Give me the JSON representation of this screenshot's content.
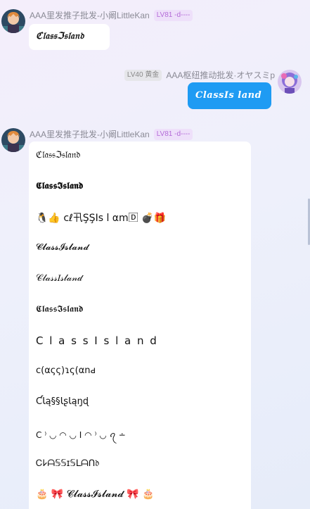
{
  "messages": [
    {
      "sender": "AAA里发推子批发-小阚LittleKan",
      "level": "LV81 -d----",
      "text": "ℭ𝔩𝔞𝔰𝔰ℑ𝔰𝔩𝔞𝔫𝔡"
    },
    {
      "sender": "AAA枢纽推动批发·オヤスミp",
      "level": "LV40 黄金",
      "text": "ClassIs land"
    },
    {
      "sender": "AAA里发推子批发-小阚LittleKan",
      "level": "LV81 -d----",
      "lines": [
        "ℭ𝔩𝔞𝔰𝔰ℑ𝔰𝔩𝔞𝔫𝔡",
        "𝕮𝖑𝖆𝖘𝖘𝕴𝖘𝖑𝖆𝖓𝖉",
        "🐧👍  cℓ卂ŞŞIs l αm🄳  💣🎁",
        "𝓒𝓵𝓪𝓼𝓼𝓘𝓼𝓵𝓪𝓷𝓭",
        "𝒞𝓁𝒶𝓈𝓈𝐼𝓈𝓁𝒶𝓃𝒹",
        "𝕮𝖑𝖆𝖘𝖘𝕴𝖘𝖑𝖆𝖓𝖉",
        "C l a s s I s l a n d",
        "c(αςς)ɿς(αnԁ",
        "ƇƖą§§ƖʂƖąŋɖ",
        "C ⁾ ◡ ◠ ◡ I ◠ ⁾ ◡ ꪖ ∸",
        "Ꮯ𐌋ᗩ𝕊𝕊ɪ𝕊ᒪᗩᑎ𝔡",
        "🎂  🎀  𝓒𝓵𝓪𝓼𝓼𝓘𝓼𝓵𝓪𝓷𝓭  🎀  🎂"
      ]
    }
  ]
}
